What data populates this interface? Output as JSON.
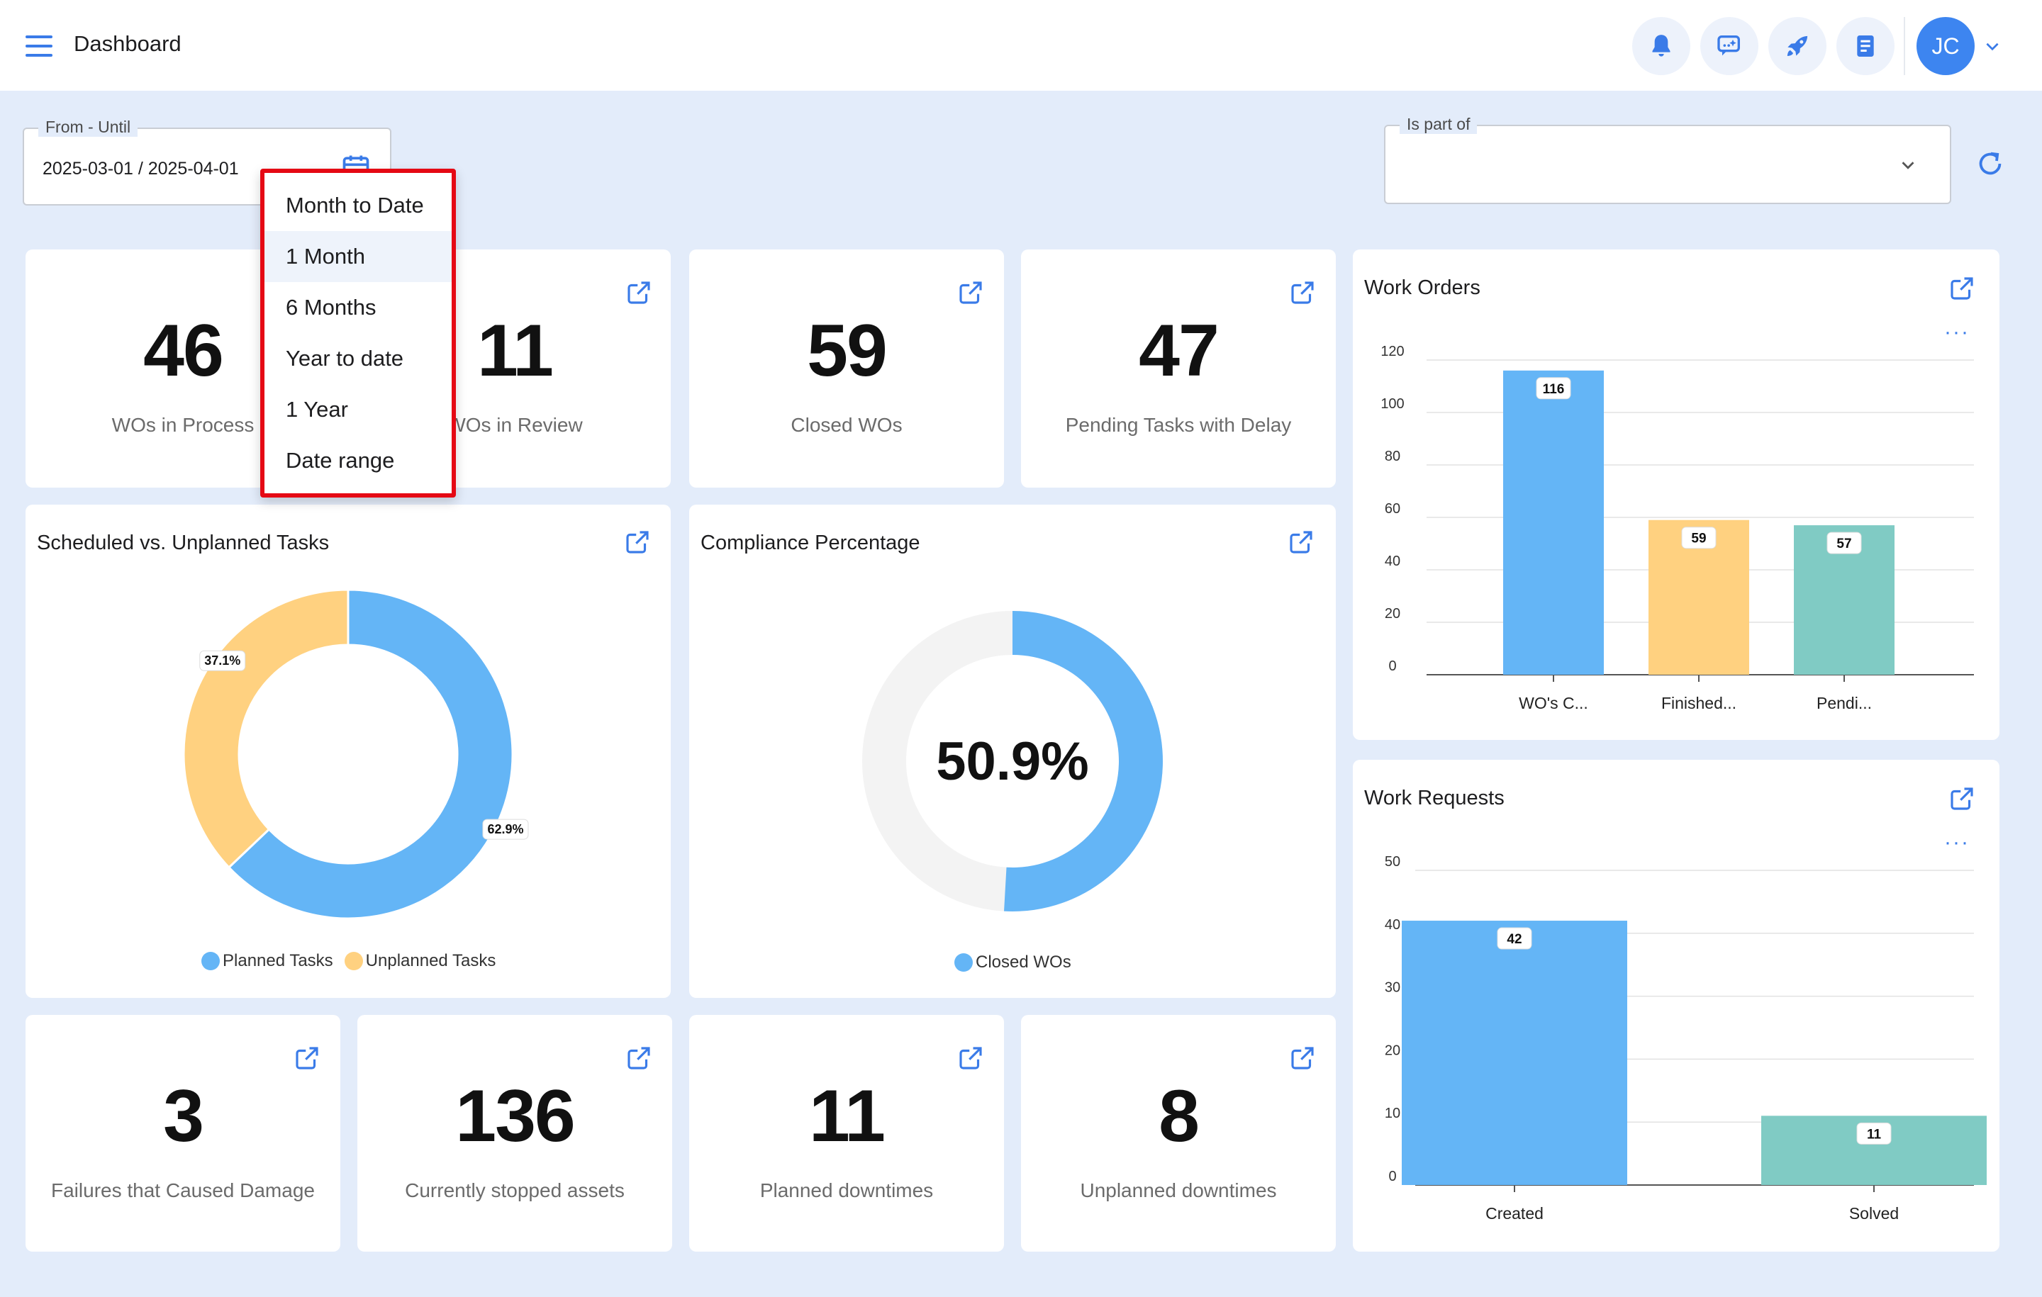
{
  "header": {
    "title": "Dashboard",
    "user_initials": "JC",
    "icons": [
      "bell-icon",
      "chat-ai-icon",
      "rocket-icon",
      "notes-icon"
    ]
  },
  "filters": {
    "date_label": "From - Until",
    "date_value": "2025-03-01 / 2025-04-01",
    "part_label": "Is part of",
    "part_value": ""
  },
  "date_menu": {
    "items": [
      "Month to Date",
      "1 Month",
      "6 Months",
      "Year to date",
      "1 Year",
      "Date range"
    ],
    "highlighted": "1 Month"
  },
  "kpis": {
    "in_process": {
      "value": "46",
      "label": "WOs in Process"
    },
    "in_review": {
      "value": "11",
      "label": "WOs in Review"
    },
    "closed": {
      "value": "59",
      "label": "Closed WOs"
    },
    "pending_delay": {
      "value": "47",
      "label": "Pending Tasks with Delay"
    },
    "failures": {
      "value": "3",
      "label": "Failures that Caused Damage"
    },
    "stopped_assets": {
      "value": "136",
      "label": "Currently stopped assets"
    },
    "planned_downtimes": {
      "value": "11",
      "label": "Planned downtimes"
    },
    "unplanned_downtimes": {
      "value": "8",
      "label": "Unplanned downtimes"
    }
  },
  "colors": {
    "blue": "#64b5f6",
    "orange": "#ffd180",
    "teal": "#80cbc4",
    "accent": "#3a7be8",
    "ring_bg": "#f3f3f3"
  },
  "chart_data": [
    {
      "type": "pie",
      "title": "Scheduled vs. Unplanned Tasks",
      "categories": [
        "Planned Tasks",
        "Unplanned Tasks"
      ],
      "values": [
        62.9,
        37.1
      ],
      "labels": [
        "62.9%",
        "37.1%"
      ],
      "legend": "bottom"
    },
    {
      "type": "pie",
      "title": "Compliance Percentage",
      "center_label": "50.9%",
      "categories": [
        "Closed WOs"
      ],
      "values": [
        50.9
      ],
      "legend": "bottom"
    },
    {
      "type": "bar",
      "title": "Work Orders",
      "categories": [
        "WO's C...",
        "Finished...",
        "Pendi..."
      ],
      "values": [
        116,
        59,
        57
      ],
      "ylim": [
        0,
        120
      ],
      "yticks": [
        "0",
        "20",
        "40",
        "60",
        "80",
        "100",
        "120"
      ],
      "grid": true
    },
    {
      "type": "bar",
      "title": "Work Requests",
      "categories": [
        "Created",
        "Solved"
      ],
      "values": [
        42,
        11
      ],
      "ylim": [
        0,
        50
      ],
      "yticks": [
        "0",
        "10",
        "20",
        "30",
        "40",
        "50"
      ],
      "grid": true
    }
  ]
}
